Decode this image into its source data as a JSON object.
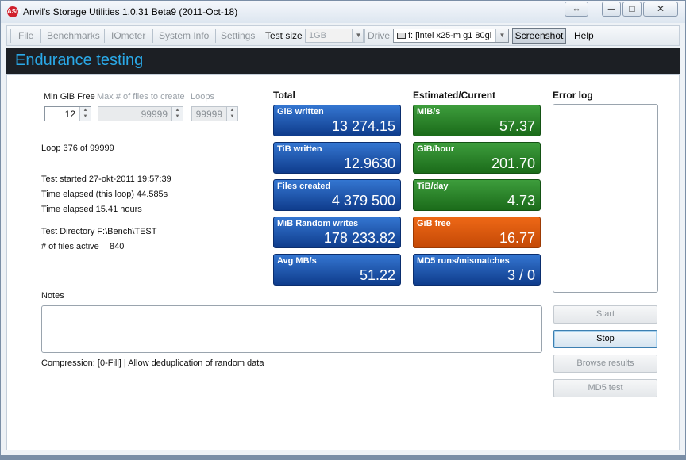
{
  "window": {
    "title": "Anvil's Storage Utilities 1.0.31 Beta9 (2011-Oct-18)",
    "icon_text": "ASU",
    "restore_icon": "⇔",
    "minimize_icon": "─",
    "maximize_icon": "□",
    "close_icon": "✕"
  },
  "toolbar": {
    "file": "File",
    "benchmarks": "Benchmarks",
    "iometer": "IOmeter",
    "system_info": "System Info",
    "settings": "Settings",
    "test_size_label": "Test size",
    "test_size_value": "1GB",
    "drive_label": "Drive",
    "drive_value": "f: [intel x25-m g1 80gl",
    "screenshot": "Screenshot",
    "help": "Help"
  },
  "page": {
    "title": "Endurance testing"
  },
  "settings": {
    "min_gib_free_label": "Min GiB Free",
    "min_gib_free_value": "12",
    "max_files_label": "Max # of files to create",
    "max_files_value": "99999",
    "loops_label": "Loops",
    "loops_value": "99999"
  },
  "info": {
    "loop": "Loop 376 of 99999",
    "test_started": "Test started 27-okt-2011 19:57:39",
    "elapsed_loop": "Time elapsed (this loop) 44.585s",
    "elapsed_total": "Time elapsed 15.41 hours",
    "test_directory": "Test Directory F:\\Bench\\TEST",
    "files_active_label": "# of files active",
    "files_active_value": "840"
  },
  "total": {
    "heading": "Total",
    "tiles": [
      {
        "label": "GiB written",
        "value": "13 274.15"
      },
      {
        "label": "TiB written",
        "value": "12.9630"
      },
      {
        "label": "Files created",
        "value": "4 379 500"
      },
      {
        "label": "MiB Random writes",
        "value": "178 233.82"
      },
      {
        "label": "Avg MB/s",
        "value": "51.22"
      }
    ]
  },
  "current": {
    "heading": "Estimated/Current",
    "tiles": [
      {
        "label": "MiB/s",
        "value": "57.37"
      },
      {
        "label": "GiB/hour",
        "value": "201.70"
      },
      {
        "label": "TiB/day",
        "value": "4.73"
      },
      {
        "label": "GiB free",
        "value": "16.77"
      },
      {
        "label": "MD5 runs/mismatches",
        "value": "3 / 0"
      }
    ]
  },
  "error_log": {
    "heading": "Error log"
  },
  "notes": {
    "label": "Notes",
    "value": ""
  },
  "compression": "Compression: [0-Fill] | Allow deduplication of random data",
  "actions": {
    "start": "Start",
    "stop": "Stop",
    "browse_results": "Browse results",
    "md5_test": "MD5 test"
  },
  "colors": {
    "header_bg": "#1c1f24",
    "header_text": "#2aa9e8",
    "tile_blue": "#1a4fa8",
    "tile_green": "#2a8a28",
    "tile_orange": "#e05a0e"
  }
}
